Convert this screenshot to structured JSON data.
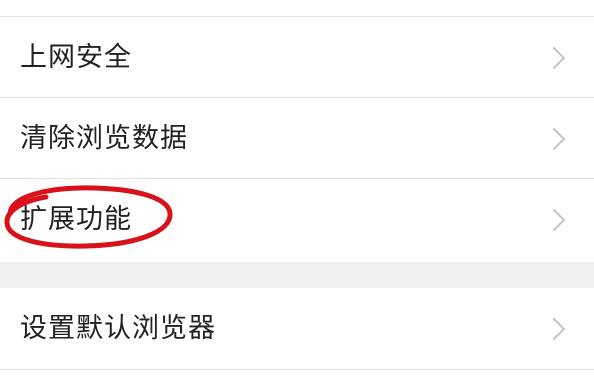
{
  "settings": {
    "items": [
      {
        "label": "上网安全"
      },
      {
        "label": "清除浏览数据"
      },
      {
        "label": "扩展功能"
      },
      {
        "label": "设置默认浏览器"
      }
    ]
  },
  "icons": {
    "chevron": "chevron-right-icon"
  },
  "colors": {
    "highlight": "#d8111a",
    "text": "#222222",
    "chevron": "#c4c4c4",
    "section_gap": "#efefef"
  }
}
